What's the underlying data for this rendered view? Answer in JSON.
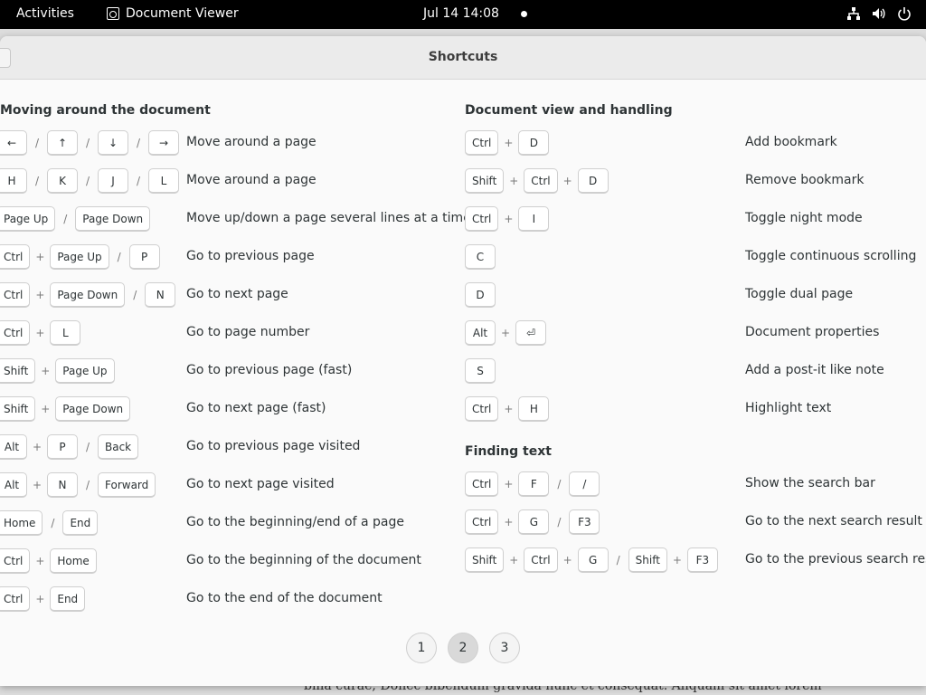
{
  "topbar": {
    "activities": "Activities",
    "app_name": "Document Viewer",
    "clock": "Jul 14  14:08",
    "tray": [
      "network-icon",
      "volume-icon",
      "power-icon"
    ]
  },
  "background_text": "bilia curae; Donec bibendum gravida nunc et consequat. Aliquam sit amet lorem",
  "dialog": {
    "title": "Shortcuts"
  },
  "left": {
    "section": "Moving around the document",
    "rows": [
      {
        "keys": [
          [
            "←"
          ],
          [
            "↑"
          ],
          [
            "↓"
          ],
          [
            "→"
          ]
        ],
        "desc": "Move around a page"
      },
      {
        "keys": [
          [
            "H"
          ],
          [
            "K"
          ],
          [
            "J"
          ],
          [
            "L"
          ]
        ],
        "desc": "Move around a page"
      },
      {
        "keys": [
          [
            "Page Up"
          ],
          [
            "Page Down"
          ]
        ],
        "desc": "Move up/down a page several lines at a time"
      },
      {
        "keys": [
          [
            "Ctrl",
            "Page Up"
          ],
          [
            "P"
          ]
        ],
        "desc": "Go to previous page"
      },
      {
        "keys": [
          [
            "Ctrl",
            "Page Down"
          ],
          [
            "N"
          ]
        ],
        "desc": "Go to next page"
      },
      {
        "keys": [
          [
            "Ctrl",
            "L"
          ]
        ],
        "desc": "Go to page number"
      },
      {
        "keys": [
          [
            "Shift",
            "Page Up"
          ]
        ],
        "desc": "Go to previous page (fast)"
      },
      {
        "keys": [
          [
            "Shift",
            "Page Down"
          ]
        ],
        "desc": "Go to next page (fast)"
      },
      {
        "keys": [
          [
            "Alt",
            "P"
          ],
          [
            "Back"
          ]
        ],
        "desc": "Go to previous page visited"
      },
      {
        "keys": [
          [
            "Alt",
            "N"
          ],
          [
            "Forward"
          ]
        ],
        "desc": "Go to next page visited"
      },
      {
        "keys": [
          [
            "Home"
          ],
          [
            "End"
          ]
        ],
        "desc": "Go to the beginning/end of a page"
      },
      {
        "keys": [
          [
            "Ctrl",
            "Home"
          ]
        ],
        "desc": "Go to the beginning of the document"
      },
      {
        "keys": [
          [
            "Ctrl",
            "End"
          ]
        ],
        "desc": "Go to the end of the document"
      }
    ]
  },
  "right": {
    "section1": "Document view and handling",
    "rows1": [
      {
        "keys": [
          [
            "Ctrl",
            "D"
          ]
        ],
        "desc": "Add bookmark"
      },
      {
        "keys": [
          [
            "Shift",
            "Ctrl",
            "D"
          ]
        ],
        "desc": "Remove bookmark"
      },
      {
        "keys": [
          [
            "Ctrl",
            "I"
          ]
        ],
        "desc": "Toggle night mode"
      },
      {
        "keys": [
          [
            "C"
          ]
        ],
        "desc": "Toggle continuous scrolling"
      },
      {
        "keys": [
          [
            "D"
          ]
        ],
        "desc": "Toggle dual page"
      },
      {
        "keys": [
          [
            "Alt",
            "⏎"
          ]
        ],
        "desc": "Document properties"
      },
      {
        "keys": [
          [
            "S"
          ]
        ],
        "desc": "Add a post-it like note"
      },
      {
        "keys": [
          [
            "Ctrl",
            "H"
          ]
        ],
        "desc": "Highlight text"
      }
    ],
    "section2": "Finding text",
    "rows2": [
      {
        "keys": [
          [
            "Ctrl",
            "F"
          ],
          [
            "/"
          ]
        ],
        "desc": "Show the search bar"
      },
      {
        "keys": [
          [
            "Ctrl",
            "G"
          ],
          [
            "F3"
          ]
        ],
        "desc": "Go to the next search result"
      },
      {
        "keys": [
          [
            "Shift",
            "Ctrl",
            "G"
          ],
          [
            "Shift",
            "F3"
          ]
        ],
        "desc": "Go to the previous search result"
      }
    ]
  },
  "pager": {
    "pages": [
      "1",
      "2",
      "3"
    ],
    "active": "2"
  }
}
